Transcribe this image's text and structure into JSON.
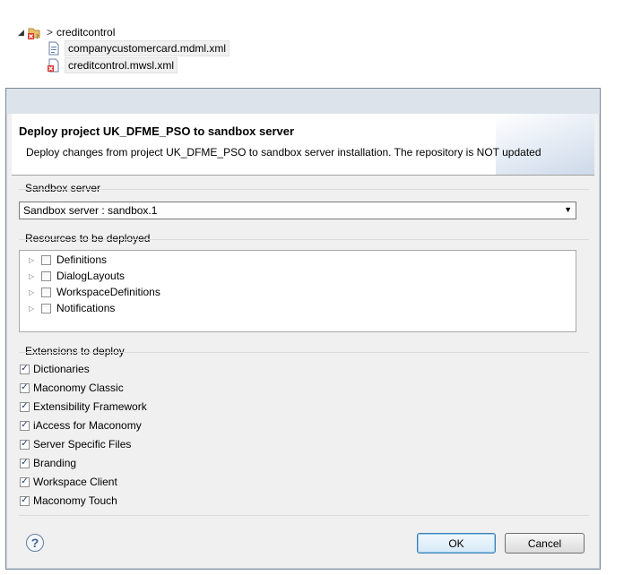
{
  "project_tree": {
    "root": {
      "label": "creditcontrol",
      "icon": "project-error-icon"
    },
    "files": [
      {
        "label": "companycustomercard.mdml.xml",
        "icon": "xml-file-icon"
      },
      {
        "label": "creditcontrol.mwsl.xml",
        "icon": "xml-file-error-icon"
      }
    ]
  },
  "dialog": {
    "title": "Deploy project UK_DFME_PSO to sandbox server",
    "description": "Deploy changes from project UK_DFME_PSO to sandbox server installation. The repository is NOT updated",
    "sandbox": {
      "group_label": "Sandbox server",
      "selected": "Sandbox server : sandbox.1"
    },
    "resources": {
      "group_label": "Resources to be deployed",
      "items": [
        {
          "label": "Definitions",
          "checked": false
        },
        {
          "label": "DialogLayouts",
          "checked": false
        },
        {
          "label": "WorkspaceDefinitions",
          "checked": false
        },
        {
          "label": "Notifications",
          "checked": false
        }
      ]
    },
    "extensions": {
      "group_label": "Extensions to deploy",
      "items": [
        {
          "label": "Dictionaries",
          "checked": true
        },
        {
          "label": "Maconomy Classic",
          "checked": true
        },
        {
          "label": "Extensibility Framework",
          "checked": true
        },
        {
          "label": "iAccess for Maconomy",
          "checked": true
        },
        {
          "label": "Server Specific Files",
          "checked": true
        },
        {
          "label": "Branding",
          "checked": true
        },
        {
          "label": "Workspace Client",
          "checked": true
        },
        {
          "label": "Maconomy Touch",
          "checked": true
        }
      ]
    },
    "buttons": {
      "ok": "OK",
      "cancel": "Cancel",
      "help": "?"
    }
  },
  "colors": {
    "ok_border": "#3c7fb1",
    "check": "#1c3a6e",
    "header_bg": "#ffffff",
    "dialog_bg": "#f0f0f0"
  }
}
